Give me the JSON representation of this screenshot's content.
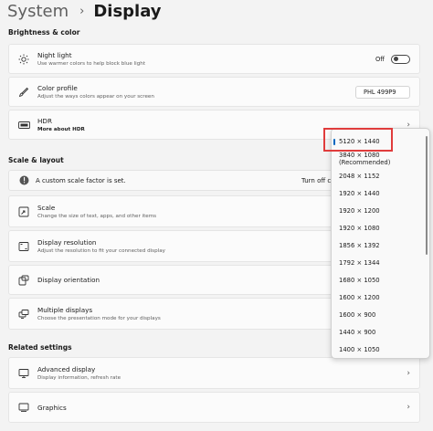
{
  "breadcrumb": {
    "parent": "System",
    "separator": "›",
    "current": "Display"
  },
  "sections": {
    "brightness": "Brightness & color",
    "scale_layout": "Scale & layout",
    "related": "Related settings"
  },
  "night_light": {
    "title": "Night light",
    "sub": "Use warmer colors to help block blue light",
    "state": "Off"
  },
  "color_profile": {
    "title": "Color profile",
    "sub": "Adjust the ways colors appear on your screen",
    "value": "PHL 499P9"
  },
  "hdr": {
    "title": "HDR",
    "sub": "More about HDR"
  },
  "info_bar": {
    "message": "A custom scale factor is set.",
    "action": "Turn off custom scaling and sign out"
  },
  "scale": {
    "title": "Scale",
    "sub": "Change the size of text, apps, and other items"
  },
  "display_resolution": {
    "title": "Display resolution",
    "sub": "Adjust the resolution to fit your connected display"
  },
  "display_orientation": {
    "title": "Display orientation"
  },
  "multiple_displays": {
    "title": "Multiple displays",
    "sub": "Choose the presentation mode for your displays"
  },
  "advanced_display": {
    "title": "Advanced display",
    "sub": "Display information, refresh rate"
  },
  "graphics": {
    "title": "Graphics"
  },
  "resolution_dropdown": {
    "selected": "5120 × 1440",
    "options": [
      "5120 × 1440",
      "3840 × 1080 (Recommended)",
      "2048 × 1152",
      "1920 × 1440",
      "1920 × 1200",
      "1920 × 1080",
      "1856 × 1392",
      "1792 × 1344",
      "1680 × 1050",
      "1600 × 1200",
      "1600 × 900",
      "1440 × 900",
      "1400 × 1050"
    ]
  },
  "colors": {
    "accent": "#0067c0",
    "highlight": "#e03c3c"
  }
}
